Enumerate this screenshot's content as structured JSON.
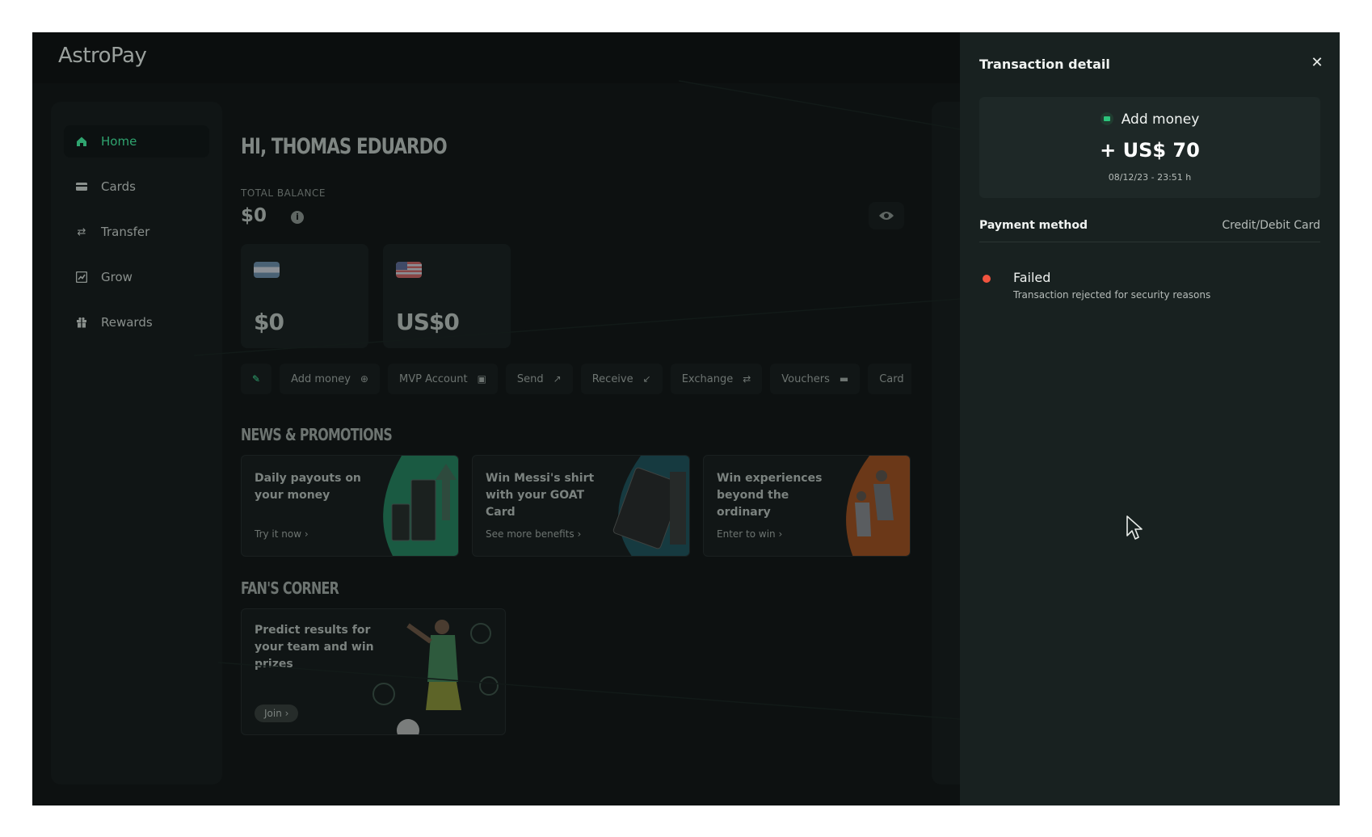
{
  "app": {
    "logo": "AstroPay"
  },
  "sidebar": {
    "items": [
      {
        "label": "Home",
        "icon": "home-icon",
        "active": true
      },
      {
        "label": "Cards",
        "icon": "card-icon",
        "active": false
      },
      {
        "label": "Transfer",
        "icon": "transfer-icon",
        "active": false
      },
      {
        "label": "Grow",
        "icon": "chart-icon",
        "active": false
      },
      {
        "label": "Rewards",
        "icon": "gift-icon",
        "active": false
      }
    ]
  },
  "main": {
    "greeting": "HI, THOMAS EDUARDO",
    "balance_label": "TOTAL BALANCE",
    "balance_value": "$0",
    "wallets": [
      {
        "flag": "argentina-flag",
        "amount": "$0"
      },
      {
        "flag": "us-flag",
        "amount": "US$0"
      }
    ],
    "actions": [
      {
        "label": "",
        "icon": "pencil-icon"
      },
      {
        "label": "Add money",
        "icon": "plus-circle-icon"
      },
      {
        "label": "MVP Account",
        "icon": "chart-box-icon"
      },
      {
        "label": "Send",
        "icon": "arrow-up-right-icon"
      },
      {
        "label": "Receive",
        "icon": "arrow-down-left-icon"
      },
      {
        "label": "Exchange",
        "icon": "exchange-icon"
      },
      {
        "label": "Vouchers",
        "icon": "voucher-icon"
      },
      {
        "label": "Card",
        "icon": ""
      }
    ],
    "news_title": "NEWS & PROMOTIONS",
    "promos": [
      {
        "title": "Daily payouts on your money",
        "link": "Try it now"
      },
      {
        "title": "Win Messi's shirt with your GOAT Card",
        "link": "See more benefits"
      },
      {
        "title": "Win experiences beyond the ordinary",
        "link": "Enter to win"
      }
    ],
    "fans_title": "FAN'S CORNER",
    "fan_card": {
      "title": "Predict results for your team and win prizes",
      "button": "Join"
    }
  },
  "panel": {
    "title": "Transaction detail",
    "type": "Add money",
    "amount": "+ US$ 70",
    "date": "08/12/23 - 23:51 h",
    "payment_method_label": "Payment method",
    "payment_method_value": "Credit/Debit Card",
    "status": "Failed",
    "status_description": "Transaction rejected for security reasons",
    "status_color": "#f1543f",
    "accent_color": "#2cc47b"
  }
}
